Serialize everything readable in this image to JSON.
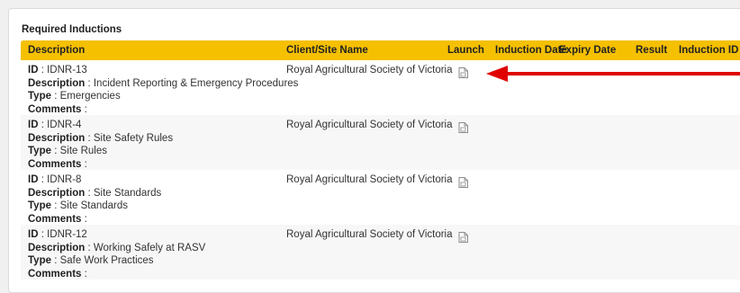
{
  "section": {
    "title": "Required Inductions"
  },
  "columns": {
    "description": "Description",
    "client": "Client/Site Name",
    "launch": "Launch",
    "induction_date": "Induction Date",
    "expiry_date": "Expiry Date",
    "result": "Result",
    "induction_id": "Induction ID"
  },
  "field_labels": {
    "id": "ID",
    "description": "Description",
    "type": "Type",
    "comments": "Comments",
    "separator": " : "
  },
  "rows": [
    {
      "id": "IDNR-13",
      "description": "Incident Reporting & Emergency Procedures",
      "type": "Emergencies",
      "comments": "",
      "client": "Royal Agricultural Society of Victoria",
      "launch_icon": "document-icon"
    },
    {
      "id": "IDNR-4",
      "description": "Site Safety Rules",
      "type": "Site Rules",
      "comments": "",
      "client": "Royal Agricultural Society of Victoria",
      "launch_icon": "document-icon"
    },
    {
      "id": "IDNR-8",
      "description": "Site Standards",
      "type": "Site Standards",
      "comments": "",
      "client": "Royal Agricultural Society of Victoria",
      "launch_icon": "document-icon"
    },
    {
      "id": "IDNR-12",
      "description": "Working Safely at RASV",
      "type": "Safe Work Practices",
      "comments": "",
      "client": "Royal Agricultural Society of Victoria",
      "launch_icon": "document-icon"
    }
  ],
  "colors": {
    "header_bg": "#f5c000",
    "annotation_arrow": "#e00000",
    "alt_row": "#f7f7f7"
  }
}
